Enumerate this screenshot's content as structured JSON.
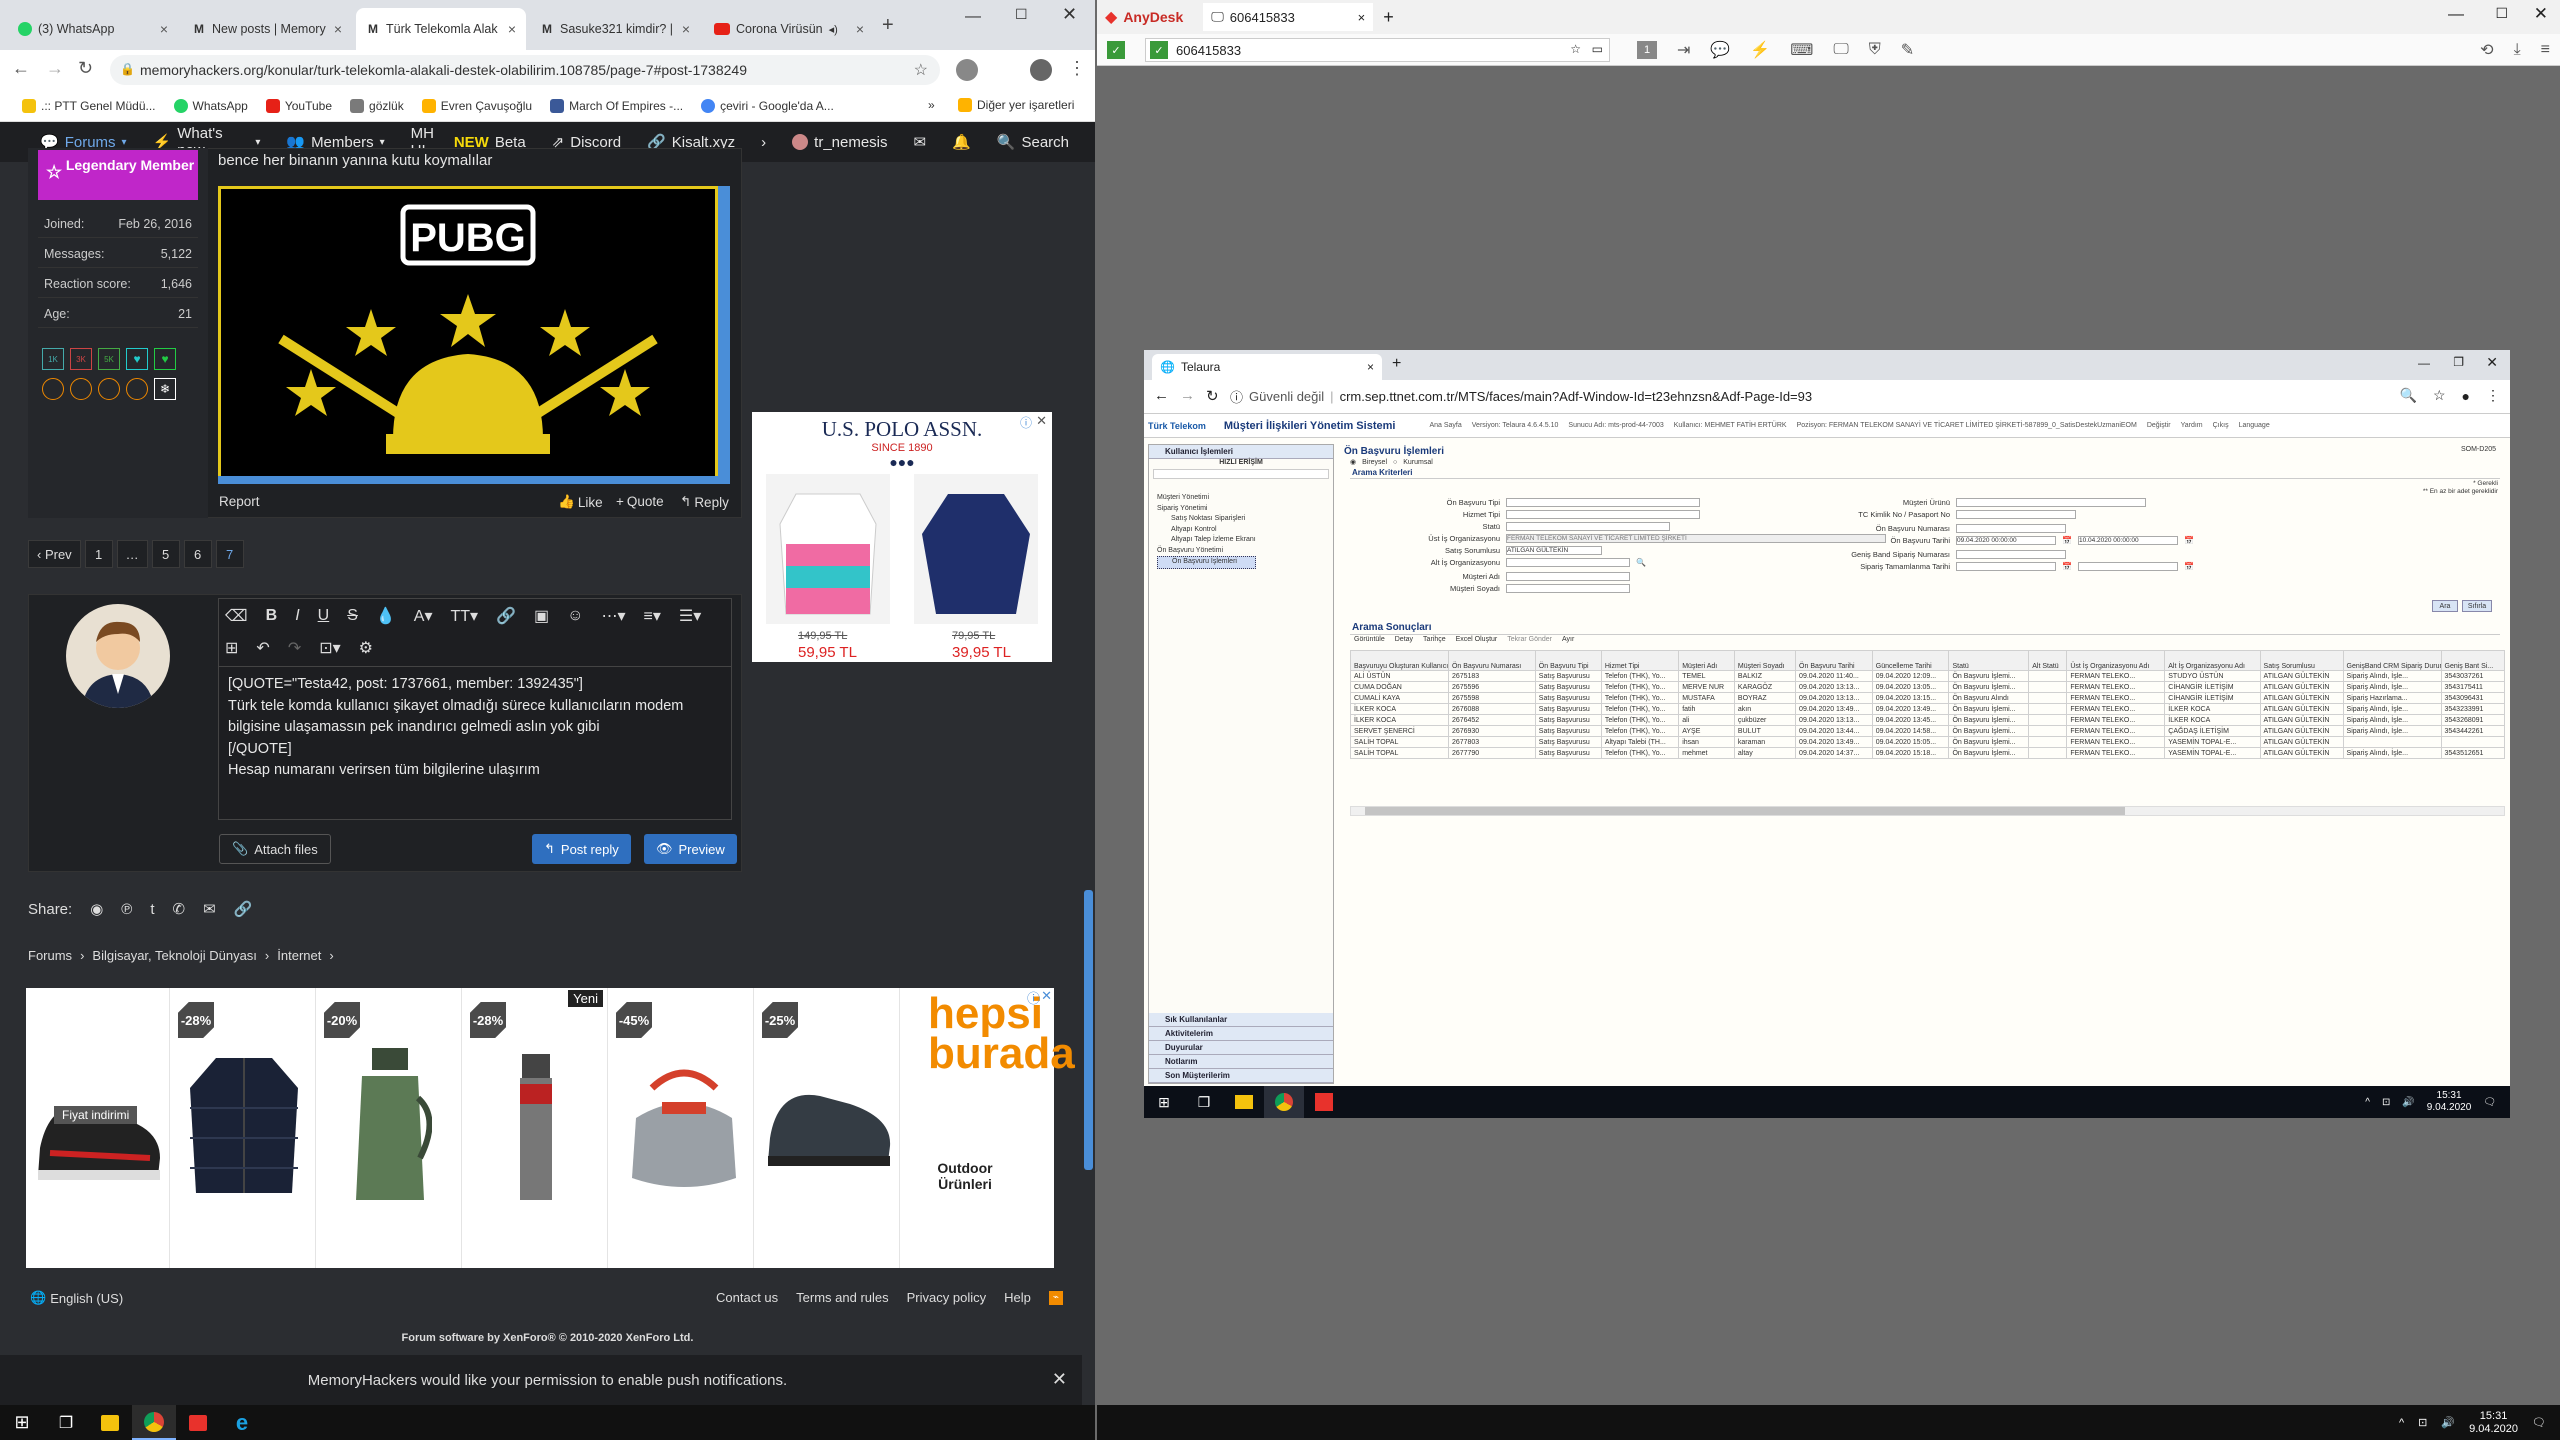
{
  "left_tabs": [
    {
      "label": "(3) WhatsApp",
      "icon": "whatsapp-icon"
    },
    {
      "label": "New posts | Memory",
      "icon": "memoryhackers-icon"
    },
    {
      "label": "Türk Telekomla Alak",
      "icon": "memoryhackers-icon"
    },
    {
      "label": "Sasuke321 kimdir? |",
      "icon": "memoryhackers-icon"
    },
    {
      "label": "Corona Virüsün",
      "icon": "youtube-icon"
    }
  ],
  "left_url": "memoryhackers.org/konular/turk-telekomla-alakali-destek-olabilirim.108785/page-7#post-1738249",
  "bookmarks": [
    {
      "label": ".:: PTT Genel Müdü...",
      "color": "#f4c20d"
    },
    {
      "label": "WhatsApp",
      "color": "#25d366"
    },
    {
      "label": "YouTube",
      "color": "#e62117"
    },
    {
      "label": "gözlük",
      "color": "#7a7a7a"
    },
    {
      "label": "Evren Çavuşoğlu",
      "color": "#ffb300"
    },
    {
      "label": "March Of Empires -...",
      "color": "#3b5998"
    },
    {
      "label": "çeviri - Google'da A...",
      "color": "#4285f4"
    }
  ],
  "bm_more": "»",
  "bm_other": "Diğer yer işaretleri",
  "nav": {
    "forums": "Forums",
    "whats_new": "What's new",
    "members": "Members",
    "mhui": "MH UI",
    "new": "NEW",
    "beta": "Beta",
    "discord": "Discord",
    "kisalt": "Kisalt.xyz",
    "user": "tr_nemesis",
    "search": "Search"
  },
  "user": {
    "badge": "Legendary Member",
    "stats": [
      {
        "k": "Joined:",
        "v": "Feb 26, 2016"
      },
      {
        "k": "Messages:",
        "v": "5,122"
      },
      {
        "k": "Reaction score:",
        "v": "1,646"
      },
      {
        "k": "Age:",
        "v": "21"
      }
    ],
    "trophies": [
      "1K",
      "3K",
      "5K"
    ]
  },
  "post": {
    "text": "bence her binanın yanına kutu koymalılar",
    "logo": "PUBG"
  },
  "actions": {
    "report": "Report",
    "like": "Like",
    "quote": "Quote",
    "reply": "Reply"
  },
  "pages": [
    "‹ Prev",
    "1",
    "…",
    "5",
    "6",
    "7"
  ],
  "editor_lines": [
    "[QUOTE=\"Testa42, post: 1737661, member: 1392435\"]",
    "Türk tele komda kullanıcı şikayet olmadığı sürece kullanıcıların modem",
    "bilgisine ulaşamassın pek inandırıcı gelmedi aslın yok gibi",
    "[/QUOTE]",
    "Hesap numaranı verirsen tüm bilgilerine ulaşırım"
  ],
  "buttons": {
    "attach": "Attach files",
    "post_reply": "Post reply",
    "preview": "Preview"
  },
  "share_label": "Share:",
  "breadcrumb": [
    "Forums",
    "Bilgisayar, Teknoloji Dünyası",
    "İnternet"
  ],
  "ad": {
    "products": [
      {
        "discount": "",
        "label": "Fiyat indirimi"
      },
      {
        "discount": "-28%",
        "label": ""
      },
      {
        "discount": "-20%",
        "label": ""
      },
      {
        "discount": "-28%",
        "label": "Yeni"
      },
      {
        "discount": "-45%",
        "label": ""
      },
      {
        "discount": "-25%",
        "label": ""
      }
    ],
    "brand1": "hepsi",
    "brand2": "burada",
    "cat1": "Outdoor",
    "cat2": "Ürünleri"
  },
  "polo": {
    "brand": "U.S. POLO ASSN.",
    "since": "SINCE 1890",
    "old1": "149,95 TL",
    "new1": "59,95 TL",
    "old2": "79,95 TL",
    "new2": "39,95 TL"
  },
  "footer": {
    "lang": "English (US)",
    "links": [
      "Contact us",
      "Terms and rules",
      "Privacy policy",
      "Help"
    ],
    "software": "Forum software by XenForo® © 2010-2020 XenForo Ltd."
  },
  "push": "MemoryHackers would like your permission to enable push notifications.",
  "anydesk": {
    "app": "AnyDesk",
    "tab": "606415833",
    "address": "606415833"
  },
  "remote": {
    "tab": "Telaura",
    "insecure": "Güvenli değil",
    "url": "crm.sep.ttnet.com.tr/MTS/faces/main?Adf-Window-Id=t23ehnzsn&Adf-Page-Id=93",
    "logo": "Türk Telekom",
    "sys_title": "Müşteri İlişkileri Yönetim Sistemi",
    "header_info": [
      "Ana Sayfa",
      "Versiyon: Telaura 4.6.4.5.10",
      "Sunucu Adı: mts-prod-44-7003",
      "Kullanıcı: MEHMET FATİH ERTÜRK",
      "Pozisyon: FERMAN TELEKOM SANAYİ VE TİCARET LİMİTED ŞİRKETİ-587899_0_SatisDestekUzmaniEOM"
    ],
    "header_links": [
      "Değiştir",
      "Yardım",
      "Çıkış",
      "Language"
    ],
    "menu_top": "Kullanıcı İşlemleri",
    "quick": "HIZLI ERİŞİM",
    "menu_items": [
      "Müşteri Yönetimi",
      "Sipariş Yönetimi",
      "Satış Noktası Siparişleri",
      "Altyapı Kontrol",
      "Altyapı Talep İzleme Ekranı",
      "Ön Başvuru Yönetimi",
      "Ön Başvuru İşlemleri"
    ],
    "menu_bottom": [
      "Sık Kullanılanlar",
      "Aktivitelerim",
      "Duyurular",
      "Notlarım",
      "Son Müşterilerim"
    ],
    "page_title": "Ön Başvuru İşlemleri",
    "radio1": "Bireysel",
    "radio2": "Kurumsal",
    "som": "SOM-D205",
    "criteria": "Arama Kriterleri",
    "required": "* Gerekli",
    "atleast": "** En az bir adet gereklidir",
    "fields_left": [
      {
        "k": "Ön Başvuru Tipi",
        "v": ""
      },
      {
        "k": "Hizmet Tipi",
        "v": ""
      },
      {
        "k": "Statü",
        "v": ""
      },
      {
        "k": "Üst İş Organizasyonu",
        "v": "FERMAN TELEKOM SANAYİ VE TİCARET LİMİTED ŞİRKETİ"
      },
      {
        "k": "Satış Sorumlusu",
        "v": "ATILGAN GÜLTEKİN"
      },
      {
        "k": "Alt İş Organizasyonu",
        "v": ""
      },
      {
        "k": "Müşteri Adı",
        "v": ""
      },
      {
        "k": "Müşteri Soyadı",
        "v": ""
      }
    ],
    "fields_right": [
      {
        "k": "Müşteri Ürünü",
        "v": ""
      },
      {
        "k": "TC Kimlik No / Pasaport No",
        "v": ""
      },
      {
        "k": "Ön Başvuru Numarası",
        "v": ""
      },
      {
        "k": "Ön Başvuru Tarihi",
        "v": "09.04.2020 00:00:00",
        "v2": "10.04.2020 00:00:00"
      },
      {
        "k": "Geniş Band Sipariş Numarası",
        "v": ""
      },
      {
        "k": "Sipariş Tamamlanma Tarihi",
        "v": ""
      }
    ],
    "search_btn": "Ara",
    "reset_btn": "Sıfırla",
    "results": "Arama Sonuçları",
    "toolbar": [
      "Görüntüle",
      "Detay",
      "Tarihçe",
      "Excel Oluştur",
      "Tekrar Gönder",
      "Ayır"
    ],
    "columns": [
      "Başvuruyu Oluşturan Kullanıcı",
      "Ön Başvuru Numarası",
      "Ön Başvuru Tipi",
      "Hizmet Tipi",
      "Müşteri Adı",
      "Müşteri Soyadı",
      "Ön Başvuru Tarihi",
      "Güncelleme Tarihi",
      "Statü",
      "Alt Statü",
      "Üst İş Organizasyonu Adı",
      "Alt İş Organizasyonu Adı",
      "Satış Sorumlusu",
      "GenişBand CRM Sipariş Durumu",
      "Geniş Bant Si..."
    ],
    "rows": [
      [
        "ALİ ÜSTÜN",
        "2675183",
        "Satış Başvurusu",
        "Telefon (THK), Yo...",
        "TEMEL",
        "BALKIZ",
        "09.04.2020 11:40...",
        "09.04.2020 12:09...",
        "Ön Başvuru İşlemi...",
        "",
        "FERMAN TELEKO...",
        "STUDYO ÜSTÜN",
        "ATILGAN GÜLTEKİN",
        "Sipariş Alındı, İşle...",
        "3543037261"
      ],
      [
        "CUMA DOĞAN",
        "2675596",
        "Satış Başvurusu",
        "Telefon (THK), Yo...",
        "MERVE NUR",
        "KARAGÖZ",
        "09.04.2020 13:13...",
        "09.04.2020 13:05...",
        "Ön Başvuru İşlemi...",
        "",
        "FERMAN TELEKO...",
        "CİHANGİR İLETİŞİM",
        "ATILGAN GÜLTEKİN",
        "Sipariş Alındı, İşle...",
        "3543175411"
      ],
      [
        "CUMALİ KAYA",
        "2675598",
        "Satış Başvurusu",
        "Telefon (THK), Yo...",
        "MUSTAFA",
        "BOYRAZ",
        "09.04.2020 13:13...",
        "09.04.2020 13:15...",
        "Ön Başvuru Alındı",
        "",
        "FERMAN TELEKO...",
        "CİHANGİR İLETİŞİM",
        "ATILGAN GÜLTEKİN",
        "Sipariş Hazırlama...",
        "3543096431"
      ],
      [
        "İLKER KOCA",
        "2676088",
        "Satış Başvurusu",
        "Telefon (THK), Yo...",
        "fatih",
        "akın",
        "09.04.2020 13:49...",
        "09.04.2020 13:49...",
        "Ön Başvuru İşlemi...",
        "",
        "FERMAN TELEKO...",
        "İLKER KOCA",
        "ATILGAN GÜLTEKİN",
        "Sipariş Alındı, İşle...",
        "3543233991"
      ],
      [
        "İLKER KOCA",
        "2676452",
        "Satış Başvurusu",
        "Telefon (THK), Yo...",
        "ali",
        "çukbüzer",
        "09.04.2020 13:13...",
        "09.04.2020 13:45...",
        "Ön Başvuru İşlemi...",
        "",
        "FERMAN TELEKO...",
        "İLKER KOCA",
        "ATILGAN GÜLTEKİN",
        "Sipariş Alındı, İşle...",
        "3543268091"
      ],
      [
        "SERVET ŞENERCİ",
        "2676930",
        "Satış Başvurusu",
        "Telefon (THK), Yo...",
        "AYŞE",
        "BULUT",
        "09.04.2020 13:44...",
        "09.04.2020 14:58...",
        "Ön Başvuru İşlemi...",
        "",
        "FERMAN TELEKO...",
        "ÇAĞDAŞ İLETİŞİM",
        "ATILGAN GÜLTEKİN",
        "Sipariş Alındı, İşle...",
        "3543442261"
      ],
      [
        "SALİH TOPAL",
        "2677803",
        "Satış Başvurusu",
        "Altyapı Talebi (TH...",
        "ihsan",
        "karaman",
        "09.04.2020 13:49...",
        "09.04.2020 15:05...",
        "Ön Başvuru İşlemi...",
        "",
        "FERMAN TELEKO...",
        "YASEMİN TOPAL-E...",
        "ATILGAN GÜLTEKİN",
        "",
        ""
      ],
      [
        "SALİH TOPAL",
        "2677790",
        "Satış Başvurusu",
        "Telefon (THK), Yo...",
        "mehmet",
        "altay",
        "09.04.2020 14:37...",
        "09.04.2020 15:18...",
        "Ön Başvuru İşlemi...",
        "",
        "FERMAN TELEKO...",
        "YASEMİN TOPAL-E...",
        "ATILGAN GÜLTEKİN",
        "Sipariş Alındı, İşle...",
        "3543512651"
      ]
    ],
    "clock_time": "15:31",
    "clock_date": "9.04.2020"
  },
  "taskbar": {
    "time": "15:31",
    "date": "9.04.2020"
  },
  "colors": {
    "accent": "#4a8ed8",
    "badge": "#c026c9",
    "xf_bg": "#2b2d31",
    "chrome_tab": "#dee1e6"
  }
}
